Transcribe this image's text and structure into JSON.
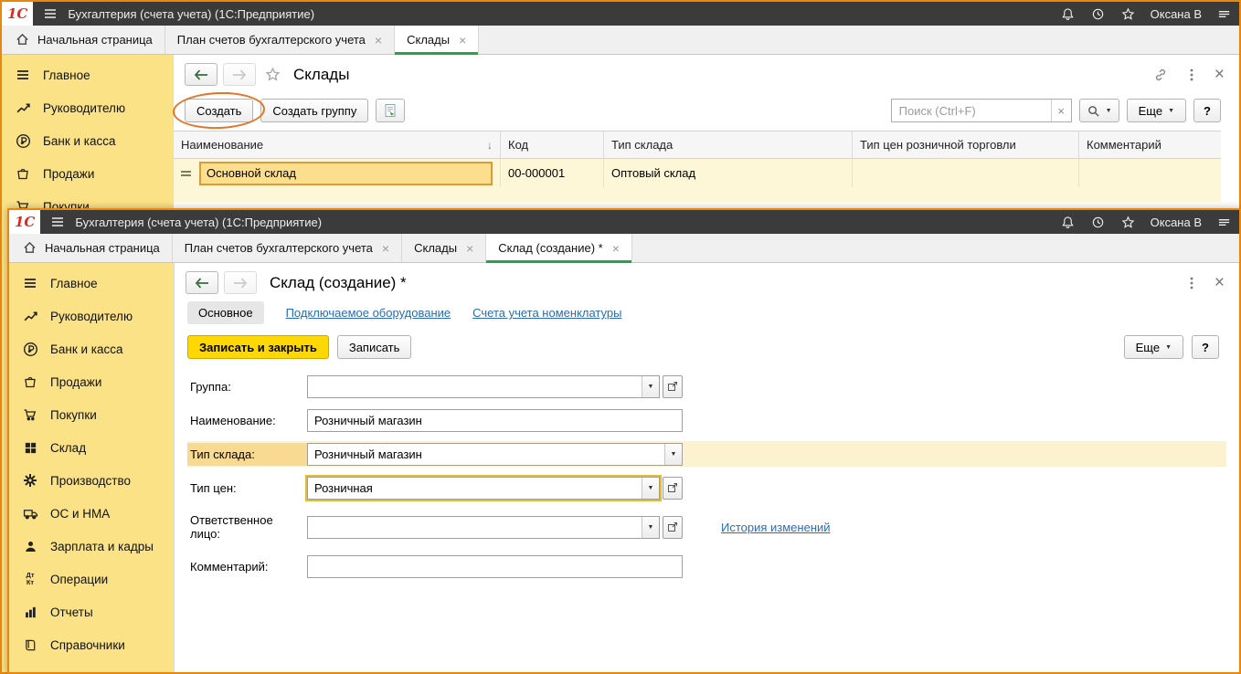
{
  "colors": {
    "window_border": "#e8870e",
    "titlebar_bg": "#3b3b3b",
    "sidebar_yellow": "#fbe287",
    "active_tab_green": "#26a248",
    "primary_button_yellow": "#ffd800",
    "selected_cell_border": "#dc9a3f",
    "row_highlight_yellow": "#fdf7d7",
    "link_blue": "#2a6db5",
    "annotation_orange": "#e0762a"
  },
  "window1": {
    "titlebar": {
      "logo": "1С",
      "title": "Бухгалтерия (счета учета)  (1С:Предприятие)",
      "user": "Оксана В"
    },
    "tabs": [
      {
        "label": "Начальная страница"
      },
      {
        "label": "План счетов бухгалтерского учета"
      },
      {
        "label": "Склады"
      }
    ],
    "sidebar": [
      {
        "label": "Главное"
      },
      {
        "label": "Руководителю"
      },
      {
        "label": "Банк и касса"
      },
      {
        "label": "Продажи"
      },
      {
        "label": "Покупки"
      }
    ],
    "page": {
      "title": "Склады",
      "toolbar": {
        "create": "Создать",
        "create_group": "Создать группу",
        "search_placeholder": "Поиск (Ctrl+F)",
        "more": "Еще",
        "help": "?"
      },
      "table": {
        "columns": [
          "Наименование",
          "Код",
          "Тип склада",
          "Тип цен розничной торговли",
          "Комментарий"
        ],
        "rows": [
          {
            "name": "Основной склад",
            "code": "00-000001",
            "type": "Оптовый склад",
            "price_type": "",
            "comment": ""
          }
        ]
      }
    }
  },
  "window2": {
    "titlebar": {
      "logo": "1С",
      "title": "Бухгалтерия (счета учета)  (1С:Предприятие)",
      "user": "Оксана В"
    },
    "tabs": [
      {
        "label": "Начальная страница"
      },
      {
        "label": "План счетов бухгалтерского учета"
      },
      {
        "label": "Склады"
      },
      {
        "label": "Склад (создание) *"
      }
    ],
    "sidebar": [
      {
        "label": "Главное"
      },
      {
        "label": "Руководителю"
      },
      {
        "label": "Банк и касса"
      },
      {
        "label": "Продажи"
      },
      {
        "label": "Покупки"
      },
      {
        "label": "Склад"
      },
      {
        "label": "Производство"
      },
      {
        "label": "ОС и НМА"
      },
      {
        "label": "Зарплата и кадры"
      },
      {
        "label": "Операции"
      },
      {
        "label": "Отчеты"
      },
      {
        "label": "Справочники"
      }
    ],
    "page": {
      "title": "Склад (создание) *",
      "nav": [
        {
          "label": "Основное"
        },
        {
          "label": "Подключаемое оборудование"
        },
        {
          "label": "Счета учета номенклатуры"
        }
      ],
      "buttons": {
        "save_close": "Записать и закрыть",
        "save": "Записать",
        "more": "Еще",
        "help": "?"
      },
      "fields": {
        "group": {
          "label": "Группа:",
          "value": ""
        },
        "name": {
          "label": "Наименование:",
          "value": "Розничный магазин"
        },
        "warehouse_type": {
          "label": "Тип склада:",
          "value": "Розничный магазин"
        },
        "price_type": {
          "label": "Тип цен:",
          "value": "Розничная"
        },
        "responsible": {
          "label": "Ответственное лицо:",
          "value": "",
          "link": "История изменений"
        },
        "comment": {
          "label": "Комментарий:",
          "value": ""
        }
      }
    }
  }
}
